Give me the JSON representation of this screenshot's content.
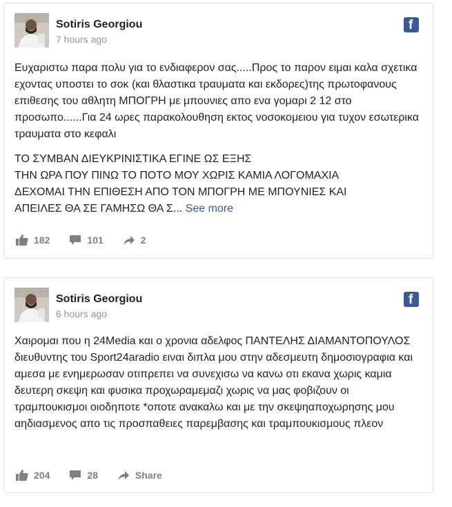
{
  "posts": [
    {
      "author": "Sotiris Georgiou",
      "time": "7 hours ago",
      "paragraphs": [
        "Ευχαριστω παρα πολυ για το ενδιαφερον σας.....Προς το παρον ειμαι καλα σχετικα εχοντας υποστει το σοκ (και θλαστικα τραυματα και εκδορες)της πρωτοφανους επιθεσης του αθλητη ΜΠΟΓΡΗ με μπουνιες απο ενα γομαρι 2 12 στο προσωπο......Για 24 ωρες παρακολουθηση εκτος νοσοκομειου για τυχον εσωτερικα τραυματα στο κεφαλι"
      ],
      "upper_lines": [
        "ΤΟ ΣΥΜΒΑΝ ΔΙΕΥΚΡΙΝΙΣΤΙΚΑ ΕΓΙΝΕ ΩΣ ΕΞΗΣ",
        "ΤΗΝ ΩΡΑ ΠΟΥ ΠΙΝΩ ΤΟ ΠΟΤΟ ΜΟΥ ΧΩΡΙΣ ΚΑΜΙΑ ΛΟΓΟΜΑΧΙΑ",
        "ΔΕΧΟΜΑΙ ΤΗΝ ΕΠΙΘΕΣΗ ΑΠΟ ΤΟΝ ΜΠΟΓΡΗ ΜΕ ΜΠΟΥΝΙΕΣ ΚΑΙ",
        "ΑΠΕΙΛΕΣ ΘΑ ΣΕ ΓΑΜΗΣΩ ΘΑ Σ..."
      ],
      "see_more": "See more",
      "likes": "182",
      "comments": "101",
      "shares": "2"
    },
    {
      "author": "Sotiris Georgiou",
      "time": "6 hours ago",
      "paragraphs": [
        "Χαιρομαι που η 24Media και ο χρονια αδελφος ΠΑΝΤΕΛΗΣ ΔΙΑΜΑΝΤΟΠΟΥΛΟΣ διευθυντης του Sport24aradio ειναι διπλα μου στην αδεσμευτη δημοσιογραφια και αμεσα με ενημερωσαν οτιπρεπει να συνεχισω να κανω οτι εκανα χωρις καμια δευτερη σκεψη και φυσικα προχωραμεμαζι χωρις να μας φοβιζουν οι τραμπουκισμοι οιοδηποτε *οποτε ανακαλω και με την σκεψηαποχωρησης μου αηδιασμενος απο τις προσπαθειες παρεμβασης και τραμπουκισμους πλεον"
      ],
      "likes": "204",
      "comments": "28",
      "share_label": "Share"
    }
  ],
  "colors": {
    "facebook_blue": "#3b5998",
    "link": "#365899",
    "muted": "#90949c",
    "action": "#7f7f7f",
    "border": "#dddfe2"
  }
}
